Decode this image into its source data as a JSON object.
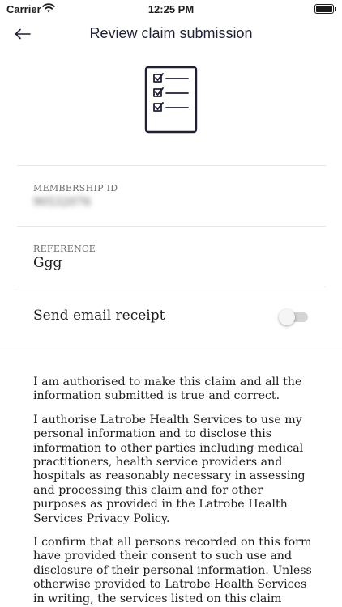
{
  "status_bar": {
    "carrier": "Carrier",
    "time": "12:25 PM",
    "icons": [
      "wifi-icon",
      "battery-icon"
    ]
  },
  "nav": {
    "back_icon": "arrow-left-icon",
    "title": "Review claim submission"
  },
  "hero": {
    "icon": "checklist-icon"
  },
  "membership": {
    "label": "MEMBERSHIP ID",
    "value": "90532076"
  },
  "reference": {
    "label": "REFERENCE",
    "value": "Ggg"
  },
  "email_receipt": {
    "label": "Send email receipt",
    "enabled": false
  },
  "declarations": [
    "I am authorised to make this claim and all the information submitted is true and correct.",
    "I authorise Latrobe Health Services to use my personal information and to disclose this information to other parties including medical practitioners, health service providers and hospitals as reasonably necessary in assessing and processing this claim and for other purposes as provided in the Latrobe Health Services Privacy Policy.",
    "I confirm that all persons recorded on this form have provided their consent to such use and disclosure of their personal information. Unless otherwise provided to Latrobe Health Services in writing, the services listed on this claim cannot be"
  ],
  "colors": {
    "navy": "#1f1f38",
    "divider": "#e6e6e6",
    "toggle_off": "#d4d4d4"
  }
}
